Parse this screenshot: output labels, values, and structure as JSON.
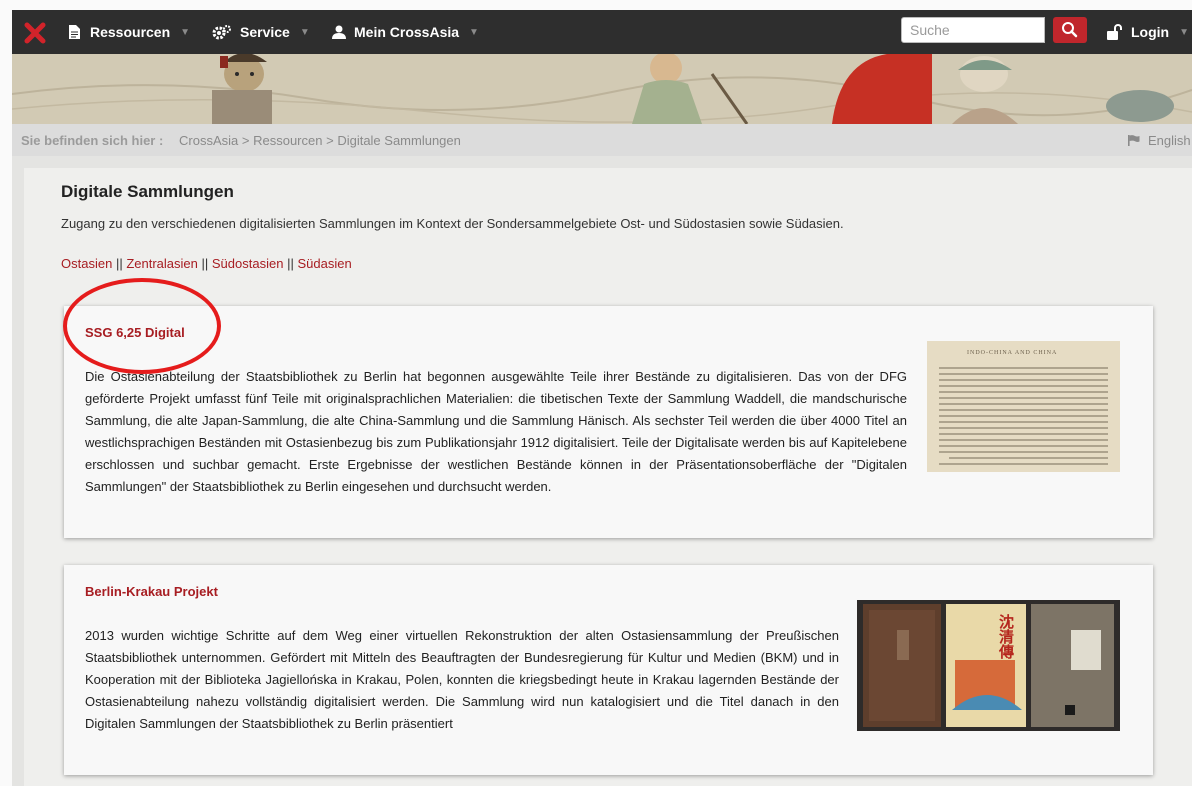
{
  "nav": {
    "items": [
      {
        "label": "Ressourcen",
        "icon": "document-icon"
      },
      {
        "label": "Service",
        "icon": "gears-icon"
      },
      {
        "label": "Mein CrossAsia",
        "icon": "user-icon"
      }
    ],
    "search_placeholder": "Suche",
    "login_label": "Login"
  },
  "breadcrumb": {
    "label": "Sie befinden sich hier :",
    "items": [
      "CrossAsia",
      "Ressourcen",
      "Digitale Sammlungen"
    ],
    "separator": ">",
    "language": "English"
  },
  "page": {
    "title": "Digitale Sammlungen",
    "intro": "Zugang zu den verschiedenen digitalisierten Sammlungen im Kontext der Sondersammelgebiete Ost- und Südostasien sowie Südasien.",
    "region_links": [
      "Ostasien",
      "Zentralasien",
      "Südostasien",
      "Südasien"
    ],
    "region_separator": "||"
  },
  "cards": [
    {
      "title": "SSG 6,25 Digital",
      "text": "Die Ostasienabteilung der Staatsbibliothek zu Berlin hat begonnen ausgewählte Teile ihrer Bestände zu digitalisieren. Das von der DFG geförderte Projekt umfasst fünf Teile mit originalsprachlichen Materialien: die tibetischen Texte der Sammlung Waddell, die mandschurische Sammlung, die alte Japan-Sammlung, die alte China-Sammlung und die Sammlung Hänisch. Als sechster Teil werden die über 4000 Titel an westlichsprachigen Beständen mit Ostasienbezug bis zum Publikationsjahr 1912 digitalisiert. Teile der Digitalisate werden bis auf Kapitelebene erschlossen und suchbar gemacht. Erste Ergebnisse der westlichen Bestände können in der Präsentationsoberfläche der \"Digitalen Sammlungen\" der Staatsbibliothek zu Berlin eingesehen und durchsucht werden.",
      "thumb_heading": "INDO-CHINA AND CHINA"
    },
    {
      "title": "Berlin-Krakau Projekt",
      "text": "2013 wurden wichtige Schritte auf dem Weg einer virtuellen Rekonstruktion der alten Ostasiensammlung der Preußischen Staatsbibliothek unternommen. Gefördert mit Mitteln des Beauftragten der Bundesregierung für Kultur und Medien (BKM) und in Kooperation mit der Biblioteka Jagiellońska in Krakau, Polen, konnten die kriegsbedingt heute in Krakau lagernden Bestände der Ostasienabteilung nahezu vollständig digitalisiert werden. Die Sammlung wird nun katalogisiert und die Titel danach in den Digitalen Sammlungen der Staatsbibliothek zu Berlin präsentiert",
      "thumb_label": "沈清傳"
    }
  ],
  "colors": {
    "navbar": "#2e2e2e",
    "accent": "#a71d22",
    "search_button": "#c0262c",
    "highlight": "#e51c1c"
  }
}
